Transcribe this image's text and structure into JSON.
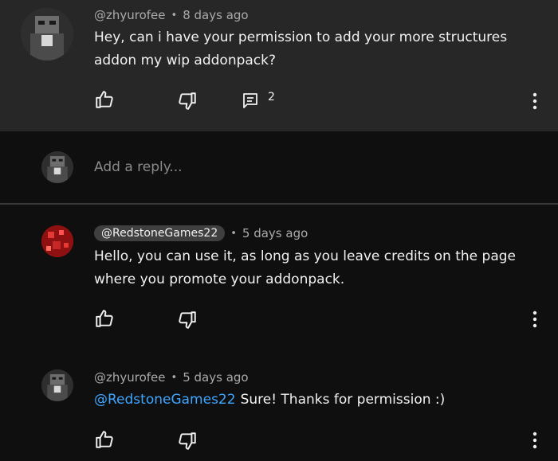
{
  "comments": [
    {
      "author": "@zhyurofee",
      "time": "8 days ago",
      "text": "Hey, can i have your permission to add your more structures addon my wip addonpack?",
      "reply_count": "2"
    },
    {
      "author": "@RedstoneGames22",
      "time": "5 days ago",
      "text": "Hello, you can use it, as long as you leave credits on the page where you promote your addonpack."
    },
    {
      "author": "@zhyurofee",
      "time": "5 days ago",
      "mention": "@RedstoneGames22",
      "text": "Sure! Thanks for permission :)"
    }
  ],
  "reply_input": {
    "placeholder": "Add a reply..."
  },
  "separator": "•",
  "colors": {
    "background": "#0f0f0f",
    "highlight_background": "#272727",
    "mention": "#3ea6ff",
    "meta_text": "#aaaaaa",
    "chip_background": "#3f3f3f"
  },
  "icons": {
    "like": "thumbs-up-icon",
    "dislike": "thumbs-down-icon",
    "replies": "comment-icon",
    "menu": "more-vertical-icon"
  }
}
